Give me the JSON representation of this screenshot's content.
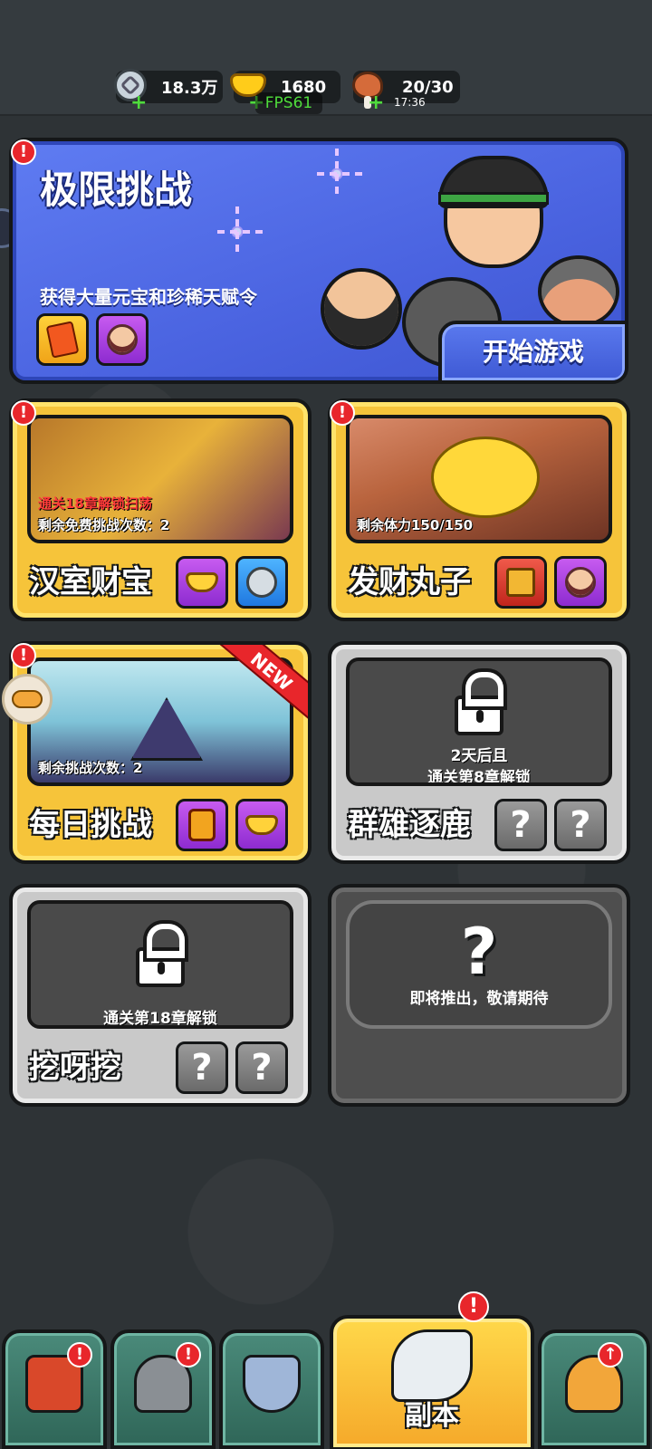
{
  "resources": {
    "silver": {
      "value": "18.3万",
      "icon": "silver-coin-icon"
    },
    "gold": {
      "value": "1680",
      "icon": "gold-ingot-icon"
    },
    "stamina": {
      "value": "20/30",
      "timer": "17:36",
      "icon": "meat-icon"
    },
    "fps": "FPS61",
    "plus": "+"
  },
  "featured": {
    "title": "极限挑战",
    "description": "获得大量元宝和珍稀天赋令",
    "start_label": "开始游戏",
    "alert": "!",
    "rewards": [
      "talent-ticket-icon",
      "hero-portrait-icon"
    ]
  },
  "modes": [
    {
      "name": "汉室财宝",
      "lock_req": "通关18章解锁扫荡",
      "info": "剩余免费挑战次数：2",
      "alert": "!",
      "rewards": [
        "gold-ingot-icon",
        "silver-coin-icon"
      ]
    },
    {
      "name": "发财丸子",
      "info": "剩余体力150/150",
      "alert": "!",
      "rewards": [
        "treasure-chest-icon",
        "hero-portrait-icon"
      ]
    },
    {
      "name": "每日挑战",
      "info": "剩余挑战次数：2",
      "alert": "!",
      "badge": "NEW",
      "rewards": [
        "talent-medal-icon",
        "gold-ingot-icon"
      ]
    },
    {
      "name": "群雄逐鹿",
      "unlock_line1": "2天后且",
      "unlock_line2": "通关第8章解锁",
      "rewards": [
        "?",
        "?"
      ]
    },
    {
      "name": "挖呀挖",
      "unlock_line1": "通关第18章解锁",
      "rewards": [
        "?",
        "?"
      ]
    },
    {
      "question": "?",
      "text": "即将推出，敬请期待"
    }
  ],
  "nav": [
    {
      "id": "shop",
      "icon": "gate-icon",
      "alert": "!"
    },
    {
      "id": "equipment",
      "icon": "helmet-icon",
      "alert": "!"
    },
    {
      "id": "talent",
      "icon": "shield-swords-icon"
    },
    {
      "id": "dungeon",
      "icon": "dragon-horn-icon",
      "label": "副本",
      "alert": "!",
      "active": true
    },
    {
      "id": "upgrade",
      "icon": "fist-upgrade-icon",
      "alert": "↑"
    }
  ],
  "colors": {
    "featured_bg": "#4a63e0",
    "card_yellow": "#f6c43a",
    "card_locked": "#c9c9c9",
    "alert_red": "#e8262b",
    "plus_green": "#4fdc3c"
  }
}
